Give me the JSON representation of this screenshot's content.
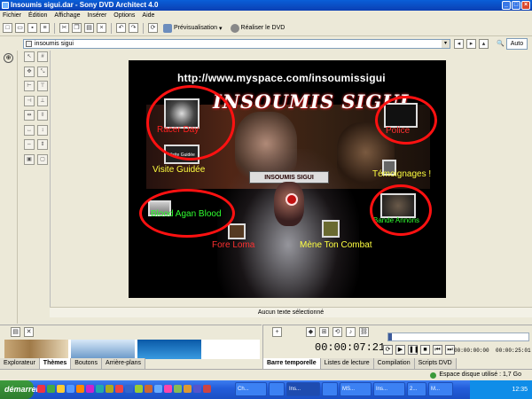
{
  "window": {
    "title": "Insoumis sigui.dar - Sony DVD Architect 4.0"
  },
  "menu": [
    "Fichier",
    "Édition",
    "Affichage",
    "Insérer",
    "Options",
    "Aide"
  ],
  "toolbar": {
    "preview_label": "Prévisualisation",
    "burn_label": "Réaliser le DVD"
  },
  "address": {
    "value": "insoumis sigui",
    "zoom_label": "Auto"
  },
  "preview": {
    "url_text": "http://www.myspace.com/insoumissigui",
    "logo_text": "INSOUMIS SIGUI",
    "center_banner": "INSOUMIS SIGUI",
    "thumb_caption": "Visite Guidée",
    "items": [
      {
        "label": "Racer Day",
        "color": "#ff2020"
      },
      {
        "label": "Visite Guidée",
        "color": "#ffff40"
      },
      {
        "label": "Blood Agan Blood",
        "color": "#30ff30"
      },
      {
        "label": "Fore Loma",
        "color": "#ff3030"
      },
      {
        "label": "Mène Ton Combat",
        "color": "#ffff40"
      },
      {
        "label": "Témoignages !",
        "color": "#ffff40"
      },
      {
        "label": "Bande Annons",
        "color": "#30ff30"
      },
      {
        "label": "Police",
        "color": "#ff3030"
      }
    ]
  },
  "canvas_status": "Aucun texte sélectionné",
  "bottom_left": {
    "tabs": [
      "Explorateur",
      "Thèmes",
      "Boutons",
      "Arrière-plans"
    ],
    "active_tab": "Thèmes"
  },
  "bottom_right": {
    "timecode": "00:00:07:21",
    "tc_start": "00:00:00:00",
    "tc_end": "00:00:25:01",
    "tabs": [
      "Barre temporelle",
      "Listes de lecture",
      "Compilation",
      "Scripts DVD"
    ],
    "active_tab": "Barre temporelle"
  },
  "statusbar": {
    "disk_label": "Espace disque utilisé : 1,7 Go"
  },
  "taskbar": {
    "start_label": "démarrer",
    "tasks": [
      "Ch...",
      "Ins...",
      "MS...",
      "Ins...",
      "2...",
      "M..."
    ],
    "clock": "12:35"
  }
}
